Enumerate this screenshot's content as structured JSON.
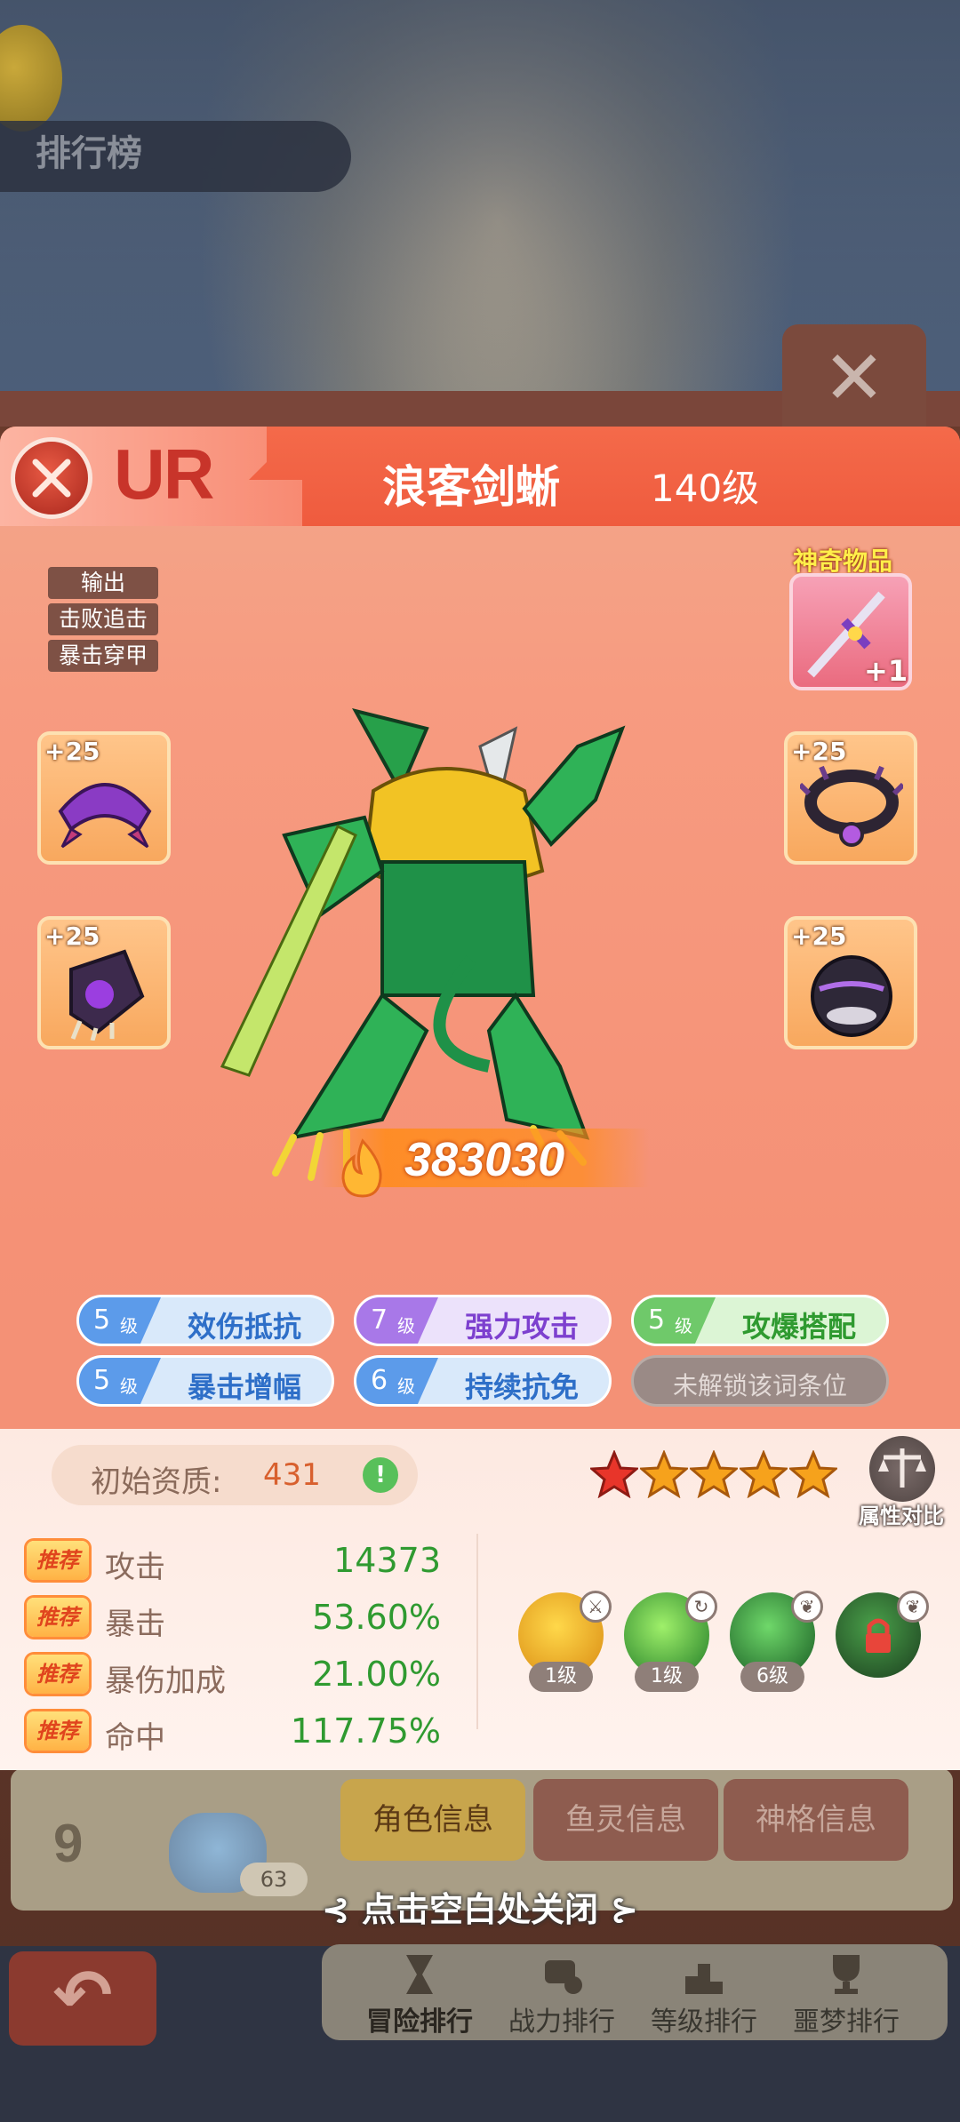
{
  "background": {
    "screen_title": "排行榜",
    "close_symbol": "✕",
    "behind_row": {
      "rank": "9",
      "level": "63"
    }
  },
  "hero": {
    "rarity": "UR",
    "name": "浪客剑蜥",
    "level": "140级",
    "tags": [
      "输出",
      "击败追击",
      "暴击穿甲"
    ],
    "power": "383030",
    "artifact_label": "神奇物品",
    "artifact_plus": "+1",
    "equipment": [
      {
        "plus": "+25",
        "icon": "purple-helmet-icon"
      },
      {
        "plus": "+25",
        "icon": "spiked-collar-icon"
      },
      {
        "plus": "+25",
        "icon": "claw-glove-icon"
      },
      {
        "plus": "+25",
        "icon": "dark-orb-armor-icon"
      }
    ]
  },
  "traits": [
    {
      "level": "5",
      "unit": "级",
      "name": "效伤抵抗",
      "color": "blue"
    },
    {
      "level": "7",
      "unit": "级",
      "name": "强力攻击",
      "color": "purple"
    },
    {
      "level": "5",
      "unit": "级",
      "name": "攻爆搭配",
      "color": "green"
    },
    {
      "level": "5",
      "unit": "级",
      "name": "暴击增幅",
      "color": "blue"
    },
    {
      "level": "6",
      "unit": "级",
      "name": "持续抗免",
      "color": "blue"
    },
    {
      "name": "未解锁该词条位",
      "color": "locked"
    }
  ],
  "aptitude": {
    "label": "初始资质:",
    "value": "431"
  },
  "stars": {
    "filled": 5,
    "total": 5
  },
  "compare_label": "属性对比",
  "stats": [
    {
      "badge": "推荐",
      "name": "攻击",
      "value": "14373"
    },
    {
      "badge": "推荐",
      "name": "暴击",
      "value": "53.60%"
    },
    {
      "badge": "推荐",
      "name": "暴伤加成",
      "value": "21.00%"
    },
    {
      "badge": "推荐",
      "name": "命中",
      "value": "117.75%"
    }
  ],
  "skills": [
    {
      "level": "1级",
      "icon": "sun-sword-skill-icon"
    },
    {
      "level": "1级",
      "icon": "green-vortex-skill-icon"
    },
    {
      "level": "6级",
      "icon": "lizard-strike-skill-icon"
    },
    {
      "level": "",
      "icon": "locked-skill-icon"
    }
  ],
  "tabs": [
    "角色信息",
    "鱼灵信息",
    "神格信息"
  ],
  "close_hint": "点击空白处关闭",
  "nav": [
    "冒险排行",
    "战力排行",
    "等级排行",
    "噩梦排行"
  ],
  "colors": {
    "panel": "#f79b80",
    "header": "#ef5b3e",
    "stat_value": "#2f9a30",
    "star": "#f6a21c"
  }
}
